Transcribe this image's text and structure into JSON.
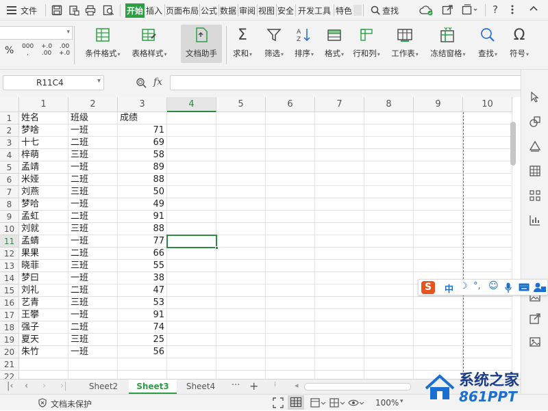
{
  "menubar": {
    "file_label": "文件",
    "tabs": [
      "开始",
      "插入",
      "页面布局",
      "公式",
      "数据",
      "审阅",
      "视图",
      "安全",
      "开发工具",
      "特色"
    ],
    "search_label": "查找"
  },
  "ribbon": {
    "number_fmt": {
      "thousands": "000",
      "inc_decimal": "+.0",
      "dec_decimal": ".00"
    },
    "buttons": [
      {
        "label": "条件格式",
        "icon": "conditional-format-icon",
        "dropdown": true
      },
      {
        "label": "表格样式",
        "icon": "table-style-icon",
        "dropdown": true
      },
      {
        "label": "文档助手",
        "icon": "doc-assistant-icon",
        "dropdown": false
      },
      {
        "label": "求和",
        "icon": "sum-icon",
        "dropdown": true
      },
      {
        "label": "筛选",
        "icon": "filter-icon",
        "dropdown": true
      },
      {
        "label": "排序",
        "icon": "sort-icon",
        "dropdown": true
      },
      {
        "label": "格式",
        "icon": "format-icon",
        "dropdown": true
      },
      {
        "label": "行和列",
        "icon": "row-col-icon",
        "dropdown": true
      },
      {
        "label": "工作表",
        "icon": "worksheet-icon",
        "dropdown": true
      },
      {
        "label": "冻结窗格",
        "icon": "freeze-pane-icon",
        "dropdown": true
      },
      {
        "label": "查找",
        "icon": "find-icon",
        "dropdown": true
      },
      {
        "label": "符号",
        "icon": "symbol-icon",
        "dropdown": true
      }
    ]
  },
  "formula_bar": {
    "name_box": "R11C4",
    "fx": "fx",
    "formula": ""
  },
  "sheet": {
    "col_headers": [
      "1",
      "2",
      "3",
      "4",
      "5",
      "6",
      "7",
      "8",
      "9",
      "10"
    ],
    "active_col": 4,
    "active_row": 11,
    "row_count": 22,
    "header": [
      "姓名",
      "班级",
      "成绩"
    ],
    "rows": [
      [
        "梦啥",
        "一班",
        "71"
      ],
      [
        "十七",
        "二班",
        "69"
      ],
      [
        "梓萌",
        "三班",
        "58"
      ],
      [
        "孟靖",
        "一班",
        "89"
      ],
      [
        "米娅",
        "二班",
        "88"
      ],
      [
        "刘燕",
        "三班",
        "50"
      ],
      [
        "梦哈",
        "一班",
        "49"
      ],
      [
        "孟虹",
        "二班",
        "91"
      ],
      [
        "刘就",
        "三班",
        "88"
      ],
      [
        "孟蜻",
        "一班",
        "77"
      ],
      [
        "果果",
        "二班",
        "66"
      ],
      [
        "晓菲",
        "三班",
        "55"
      ],
      [
        "梦曰",
        "一班",
        "38"
      ],
      [
        "刘礼",
        "二班",
        "47"
      ],
      [
        "艺青",
        "三班",
        "53"
      ],
      [
        "王攀",
        "一班",
        "91"
      ],
      [
        "强子",
        "二班",
        "74"
      ],
      [
        "夏天",
        "三班",
        "25"
      ],
      [
        "朱竹",
        "一班",
        "56"
      ]
    ]
  },
  "sheet_tabs": {
    "tabs": [
      "Sheet2",
      "Sheet3",
      "Sheet4"
    ],
    "active": "Sheet3",
    "more": "···",
    "add": "+"
  },
  "status": {
    "protect": "文档未保护",
    "zoom": "100%"
  },
  "ime": {
    "logo": "S",
    "mode": "中"
  },
  "watermark": {
    "title": "系统之家",
    "sub": "861PPT"
  },
  "colors": {
    "accent": "#2aa043",
    "selection": "#2a8a3e",
    "ime_logo": "#e8541e",
    "ime_icons": "#1a6fd1"
  }
}
